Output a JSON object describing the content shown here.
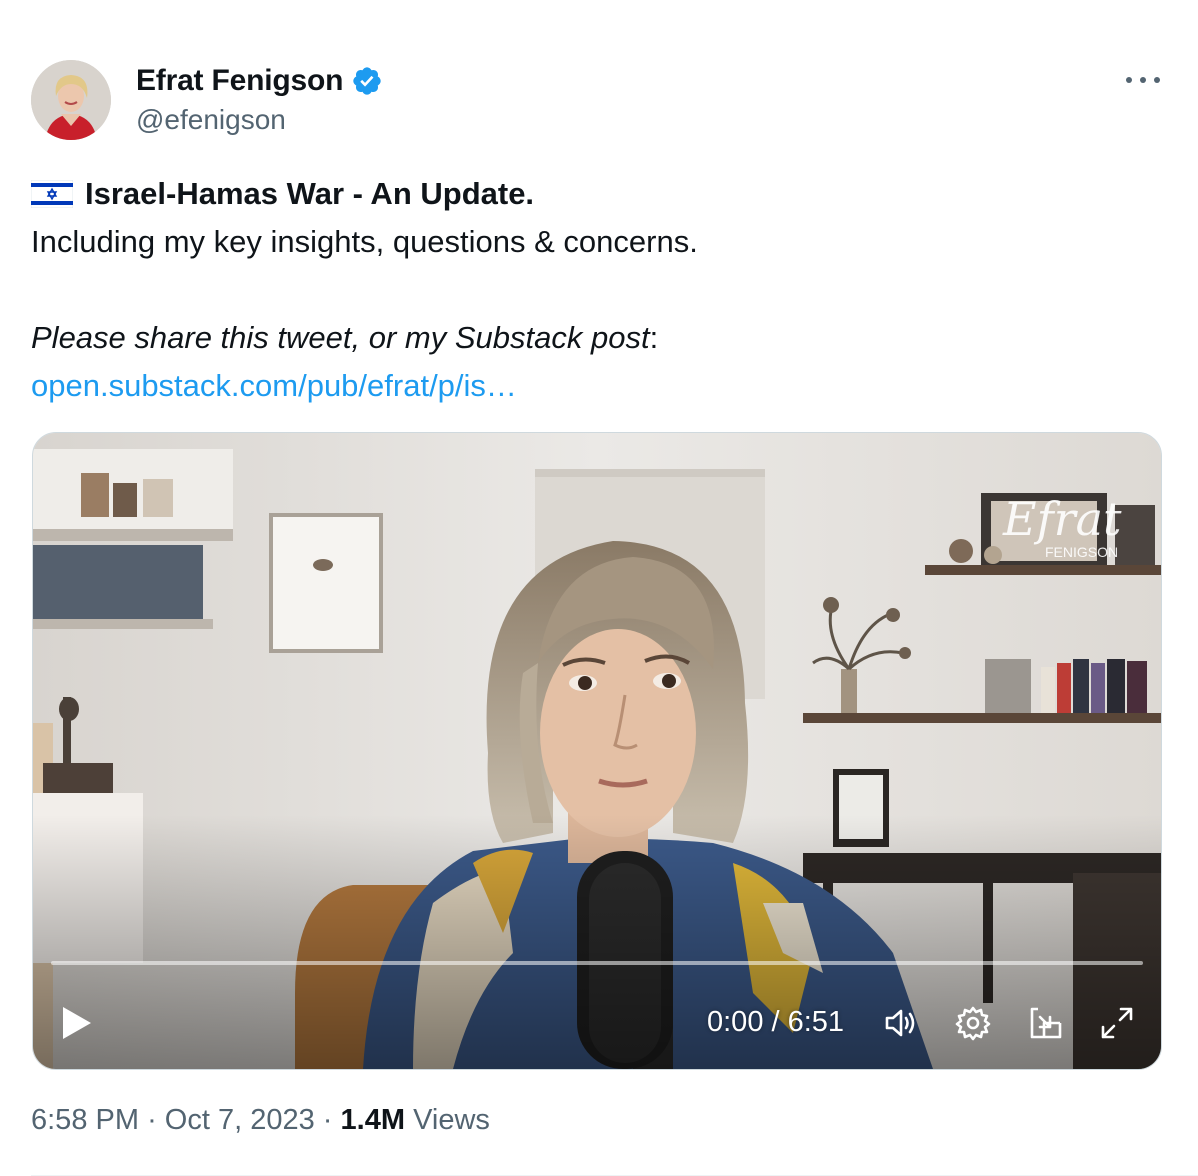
{
  "author": {
    "name": "Efrat Fenigson",
    "handle": "@efenigson",
    "verified_icon": "verified-badge-icon",
    "verified_color": "#1d9bf0"
  },
  "menu": {
    "icon": "more-horizontal-icon"
  },
  "tweet": {
    "flag_icon": "israel-flag-icon",
    "headline": "Israel-Hamas War - An Update.",
    "line2": "Including my key insights, questions & concerns.",
    "line3_italic": "Please share this tweet, or my Substack post",
    "line3_end": ":",
    "link_text": "open.substack.com/pub/efrat/p/is…",
    "link_color": "#1d9bf0"
  },
  "video": {
    "watermark_script": "Efrat",
    "watermark_text": "FENIGSON",
    "time": "0:00 / 6:51",
    "progress": 0,
    "controls": {
      "play_icon": "play-icon",
      "volume_icon": "volume-icon",
      "settings_icon": "settings-gear-icon",
      "dock_icon": "picture-in-picture-icon",
      "fullscreen_icon": "fullscreen-icon"
    }
  },
  "footer": {
    "time": "6:58 PM",
    "sep1": "·",
    "date": "Oct 7, 2023",
    "sep2": "·",
    "views_count": "1.4M",
    "views_label": "Views"
  }
}
